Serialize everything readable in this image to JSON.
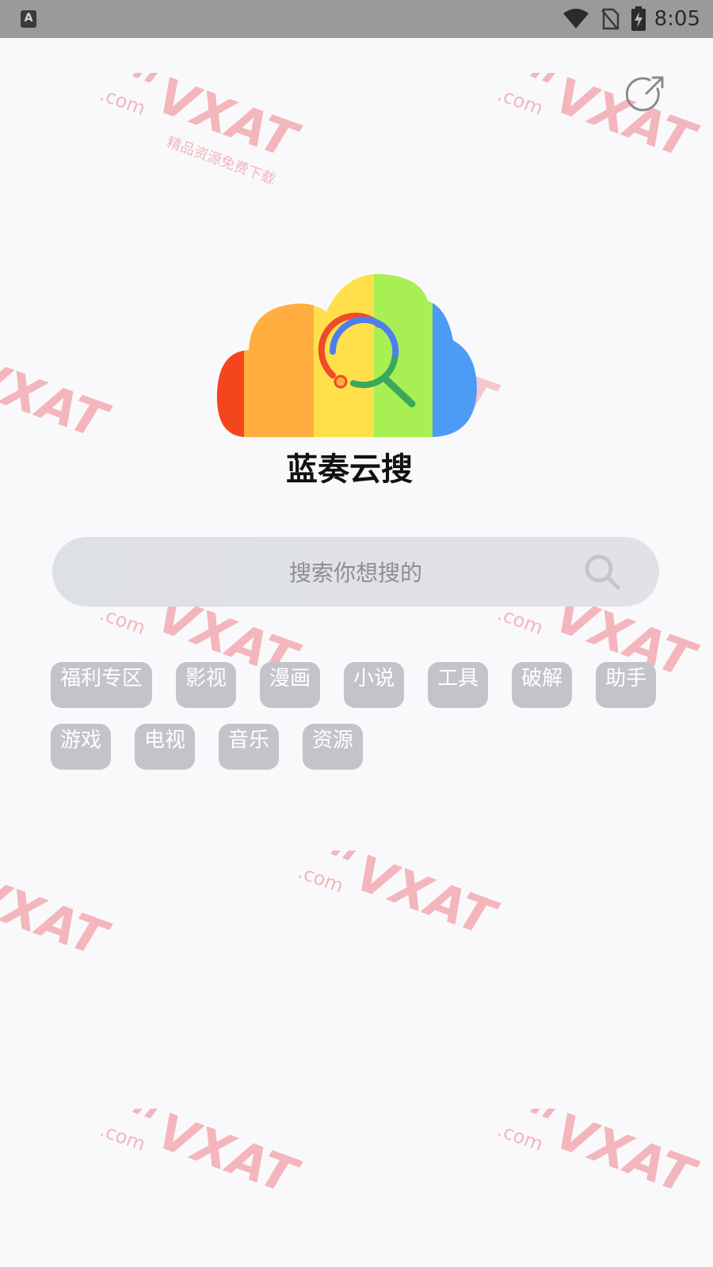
{
  "status_bar": {
    "time": "8:05",
    "app_icon_letter": "A",
    "bg_color": "#9a9a9a"
  },
  "watermark": {
    "brand": "VXAT",
    "suffix": ".com",
    "tagline": "精品资源免费下载",
    "color": "#f2a0a8"
  },
  "header": {
    "share_icon": "share-external-icon"
  },
  "logo": {
    "icon": "cloud-search-logo-icon",
    "colors": [
      "#f5451f",
      "#ffae3f",
      "#ffe04a",
      "#a8ef54",
      "#4c9cf6"
    ]
  },
  "app": {
    "title": "蓝奏云搜"
  },
  "search": {
    "placeholder": "搜索你想搜的",
    "icon": "search-icon"
  },
  "tags": {
    "row1": [
      "福利专区",
      "影视",
      "漫画",
      "小说",
      "工具",
      "破解",
      "助手"
    ],
    "row2": [
      "游戏",
      "电视",
      "音乐",
      "资源"
    ],
    "bg_color": "#c2c4c9"
  }
}
